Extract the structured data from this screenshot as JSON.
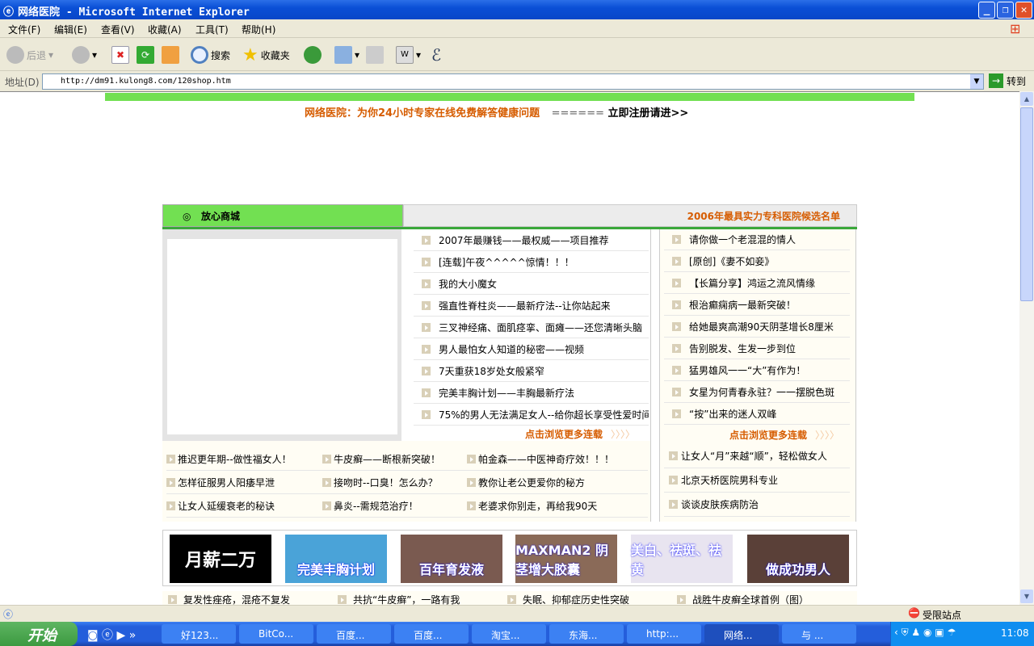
{
  "window": {
    "title": "网络医院 - Microsoft Internet Explorer",
    "min": "_",
    "restore": "❐",
    "close": "✕"
  },
  "menu": [
    "文件(F)",
    "编辑(E)",
    "查看(V)",
    "收藏(A)",
    "工具(T)",
    "帮助(H)"
  ],
  "toolbar": {
    "back": "后退",
    "search": "搜索",
    "favorites": "收藏夹"
  },
  "address": {
    "label": "地址(D)",
    "url": "http://dm91.kulong8.com/120shop.htm",
    "go": "转到"
  },
  "page": {
    "banner_text": "网络医院：为你24小时专家在线免费解答健康问题",
    "banner_sep": "======",
    "register": "立即注册请进>>",
    "tab_left": "放心商城",
    "tab_right": "2006年最具实力专科医院候选名单",
    "middle_list": [
      "2007年最赚钱——最权威——项目推荐",
      "[连载]午夜^^^^^惊情！！！",
      "我的大小魔女",
      "强直性脊柱炎——最新疗法--让你站起来",
      "三叉神经痛、面肌痉挛、面瘫——还您清晰头脑",
      "男人最怕女人知道的秘密——视频",
      "7天重获18岁处女般紧窄",
      "完美丰胸计划——丰胸最新疗法",
      "75%的男人无法满足女人--给你超长享受性爱时间"
    ],
    "right_list": [
      "请你做一个老混混的情人",
      "[原创]《妻不如妾》",
      "【长篇分享】鸿运之流风情缘",
      "根治癫痫病一最新突破！",
      "给她最爽高潮90天阴茎增长8厘米",
      "告别脱发、生发一步到位",
      "猛男雄风一一“大”有作为！",
      "女星为何青春永驻？一一摆脱色斑",
      "“按”出来的迷人双峰"
    ],
    "more": "点击浏览更多连载",
    "more_arrows": "〉〉〉〉",
    "right_extra": [
      "让女人“月”来越“顺”，轻松做女人",
      "北京天桥医院男科专业",
      "谈谈皮肤疾病防治"
    ],
    "grid": [
      [
        "推迟更年期--做性福女人！",
        "牛皮癣——断根新突破！",
        "帕金森——中医神奇疗效！！！"
      ],
      [
        "怎样征服男人阳痿早泄",
        "接吻时--口臭！怎么办？",
        "教你让老公更爱你的秘方"
      ],
      [
        "让女人延缓衰老的秘诀",
        "鼻炎--需规范治疗！",
        "老婆求你别走，再给我90天"
      ]
    ],
    "banners": [
      {
        "text": "月薪二万",
        "color": "#000000"
      },
      {
        "text": "完美丰胸计划",
        "color": "#4aa3d8"
      },
      {
        "text": "百年育发液",
        "color": "#7a5a50"
      },
      {
        "text": "MAXMAN2 阴茎增大胶囊",
        "color": "#8a6a58"
      },
      {
        "text": "美白、祛斑、祛黄",
        "color": "#e8e4f0"
      },
      {
        "text": "做成功男人",
        "color": "#5a4038"
      }
    ],
    "bottom_row": [
      "复发性痤疮，混疮不复发",
      "共抗“牛皮癣”，一路有我",
      "失眠、抑郁症历史性突破",
      "战胜牛皮癣全球首例（图）"
    ]
  },
  "status": {
    "zone": "受限站点"
  },
  "taskbar": {
    "start": "开始",
    "tasks": [
      "好123...",
      "BitCo...",
      "百度...",
      "百度...",
      "淘宝...",
      "东海...",
      "http:...",
      "网络...",
      "与  ..."
    ],
    "active": 7,
    "time": "11:08"
  },
  "colors": {
    "green": "#72e052",
    "orange": "#d65c00",
    "xp_blue": "#245edb"
  }
}
